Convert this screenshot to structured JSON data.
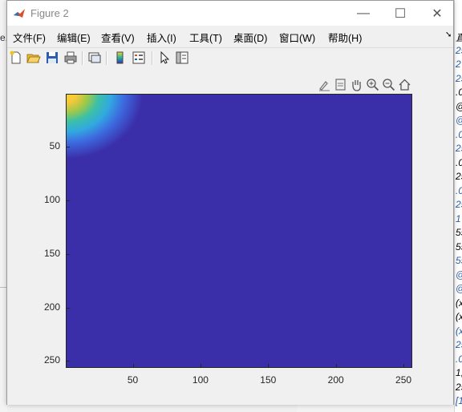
{
  "window": {
    "title": "Figure 2",
    "controls": {
      "minimize": "—",
      "maximize": "☐",
      "close": "✕"
    }
  },
  "menu": {
    "items": [
      "文件(F)",
      "编辑(E)",
      "查看(V)",
      "插入(I)",
      "工具(T)",
      "桌面(D)",
      "窗口(W)",
      "帮助(H)"
    ],
    "overflow_glyph": "➘"
  },
  "toolbar": {
    "icons": [
      "new-figure-icon",
      "open-file-icon",
      "save-icon",
      "print-icon",
      "link-plot-icon",
      "insert-colorbar-icon",
      "insert-legend-icon",
      "edit-plot-icon",
      "property-inspector-icon"
    ]
  },
  "axes_toolbar": {
    "icons": [
      "brush-icon",
      "data-tips-icon",
      "pan-icon",
      "zoom-in-icon",
      "zoom-out-icon",
      "home-icon"
    ]
  },
  "chart_data": {
    "type": "heatmap",
    "x_ticks": [
      "50",
      "100",
      "150",
      "200",
      "250"
    ],
    "y_ticks": [
      "50",
      "100",
      "150",
      "200",
      "250"
    ],
    "xlim": [
      0.5,
      256.5
    ],
    "ylim": [
      0.5,
      256.5
    ],
    "y_direction": "reverse",
    "colormap": "parula",
    "colors": {
      "background": "#3b2ea9",
      "peak": "#f3d526"
    }
  },
  "background": {
    "left_fragment": "e.",
    "right_fragments": [
      "直",
      "25",
      "2",
      "25",
      ".0",
      "@",
      "@",
      ".0",
      "25",
      ".0",
      "25",
      ".0",
      "25",
      "1",
      "55",
      "55",
      "55",
      "@",
      "@",
      "(x",
      "(x",
      "(x",
      "25",
      ".0",
      "1,",
      "25",
      "[1"
    ]
  }
}
